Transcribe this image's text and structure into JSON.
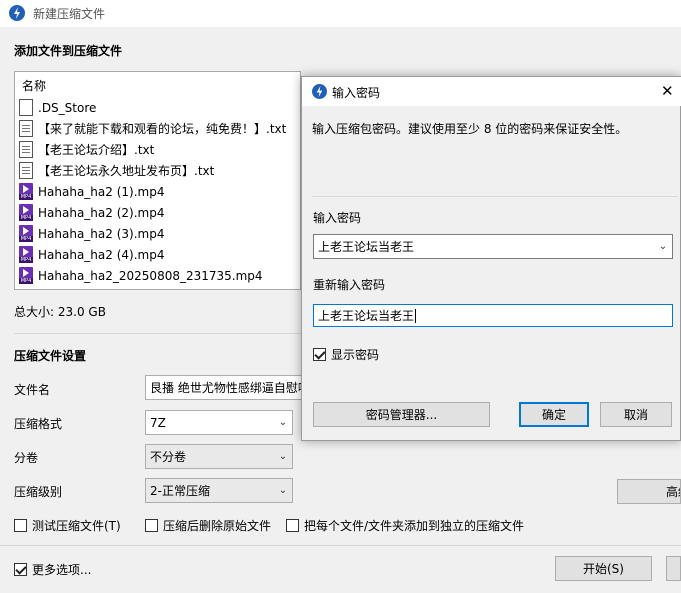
{
  "window": {
    "title": "新建压缩文件"
  },
  "add_section": {
    "title": "添加文件到压缩文件",
    "column_header": "名称",
    "files": [
      {
        "name": ".DS_Store",
        "icon": "blank-file-icon"
      },
      {
        "name": "【来了就能下载和观看的论坛，纯免费！】.txt",
        "icon": "text-file-icon"
      },
      {
        "name": "【老王论坛介绍】.txt",
        "icon": "text-file-icon"
      },
      {
        "name": "【老王论坛永久地址发布页】.txt",
        "icon": "text-file-icon"
      },
      {
        "name": "Hahaha_ha2 (1).mp4",
        "icon": "mp4-file-icon"
      },
      {
        "name": "Hahaha_ha2 (2).mp4",
        "icon": "mp4-file-icon"
      },
      {
        "name": "Hahaha_ha2 (3).mp4",
        "icon": "mp4-file-icon"
      },
      {
        "name": "Hahaha_ha2 (4).mp4",
        "icon": "mp4-file-icon"
      },
      {
        "name": "Hahaha_ha2_20250808_231735.mp4",
        "icon": "mp4-file-icon"
      }
    ],
    "total_size": "总大小: 23.0 GB"
  },
  "settings": {
    "title": "压缩文件设置",
    "filename_label": "文件名",
    "filename_value": "艮播 绝世尤物性感绑逼自慰喷",
    "format_label": "压缩格式",
    "format_value": "7Z",
    "split_label": "分卷",
    "split_value": "不分卷",
    "level_label": "压缩级别",
    "level_value": "2-正常压缩",
    "advanced_button": "高级",
    "test_checkbox": "测试压缩文件(T)",
    "delete_checkbox": "压缩后删除原始文件",
    "separate_checkbox": "把每个文件/文件夹添加到独立的压缩文件",
    "more_options": "更多选项...",
    "start_button": "开始(S)"
  },
  "password_dialog": {
    "title": "输入密码",
    "close_glyph": "✕",
    "hint": "输入压缩包密码。建议使用至少 8 位的密码来保证安全性。",
    "password_label": "输入密码",
    "password_value": "上老王论坛当老王",
    "confirm_label": "重新输入密码",
    "confirm_value": "上老王论坛当老王",
    "show_password": "显示密码",
    "show_password_checked": true,
    "manager_button": "密码管理器...",
    "ok_button": "确定",
    "cancel_button": "取消"
  },
  "colors": {
    "accent": "#0078d7",
    "app_icon": "#1f5fb8",
    "mp4_icon": "#6a2fb5"
  }
}
